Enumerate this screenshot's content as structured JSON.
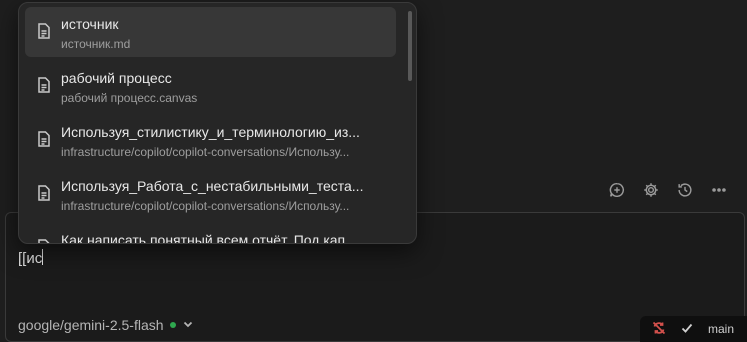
{
  "suggestions": [
    {
      "title": "источник",
      "path": "источник.md",
      "icon": "file-icon"
    },
    {
      "title": "рабочий процесс",
      "path": "рабочий процесс.canvas",
      "icon": "file-icon"
    },
    {
      "title": "Используя_стилистику_и_терминологию_из...",
      "path": "infrastructure/copilot/copilot-conversations/Использу...",
      "icon": "file-icon"
    },
    {
      "title": "Используя_Работа_с_нестабильными_теста...",
      "path": "infrastructure/copilot/copilot-conversations/Использу...",
      "icon": "file-icon"
    },
    {
      "title": "Как написать понятный всем отчёт. Под кап...",
      "path": "",
      "icon": "file-icon"
    }
  ],
  "chat": {
    "input_value": "[[ис",
    "model": "google/gemini-2.5-flash",
    "model_status_color": "#2fa84f"
  },
  "toolbar": {
    "icons": [
      "new-chat-icon",
      "settings-icon",
      "history-icon",
      "more-icon"
    ]
  },
  "git": {
    "branch": "main",
    "sync_color": "#d2504c"
  }
}
